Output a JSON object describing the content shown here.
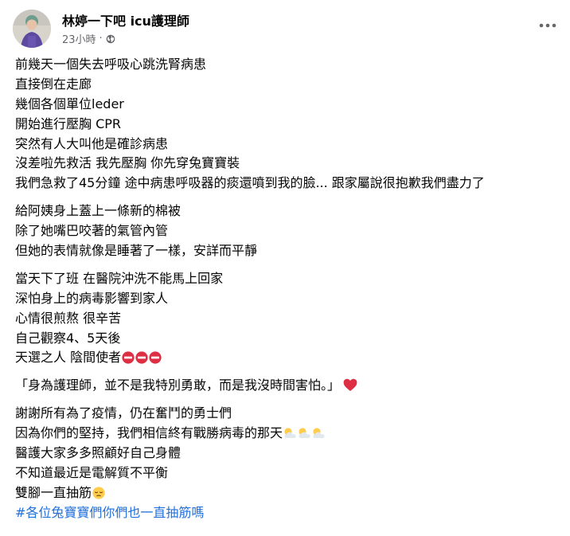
{
  "post": {
    "author": "林婷一下吧 icu護理師",
    "time": "23小時",
    "audience_icon": "globe-icon",
    "more_icon": "more-options-icon",
    "paragraphs": [
      [
        "前幾天一個失去呼吸心跳洗腎病患",
        "直接倒在走廊",
        "幾個各個單位leder",
        "開始進行壓胸 CPR",
        "突然有人大叫他是確診病患",
        "沒差啦先救活 我先壓胸 你先穿兔寶寶裝",
        "我們急救了45分鐘 途中病患呼吸器的痰還噴到我的臉... 跟家屬說很抱歉我們盡力了"
      ],
      [
        "給阿姨身上蓋上一條新的棉被",
        "除了她嘴巴咬著的氣管內管",
        "但她的表情就像是睡著了一樣，安詳而平靜"
      ],
      [
        "當天下了班 在醫院沖洗不能馬上回家",
        "深怕身上的病毒影響到家人",
        "心情很煎熬 很辛苦",
        "自己觀察4、5天後",
        "天選之人 陰間使者"
      ],
      [
        "「身為護理師，並不是我特別勇敢，而是我沒時間害怕。」"
      ],
      [
        "謝謝所有為了疫情，仍在奮鬥的勇士們",
        "因為你們的堅持，我們相信終有戰勝病毒的那天",
        "醫護大家多多照顧好自己身體",
        "不知道最近是電解質不平衡",
        "雙腳一直抽筋"
      ]
    ],
    "hashtag": "#各位兔寶寶們你們也一直抽筋嗎",
    "emoji": {
      "no_entry": "no-entry-emoji",
      "heart": "red-heart-emoji",
      "sun_behind_cloud": "sun-behind-cloud-emoji",
      "pensive": "pensive-face-emoji"
    }
  }
}
